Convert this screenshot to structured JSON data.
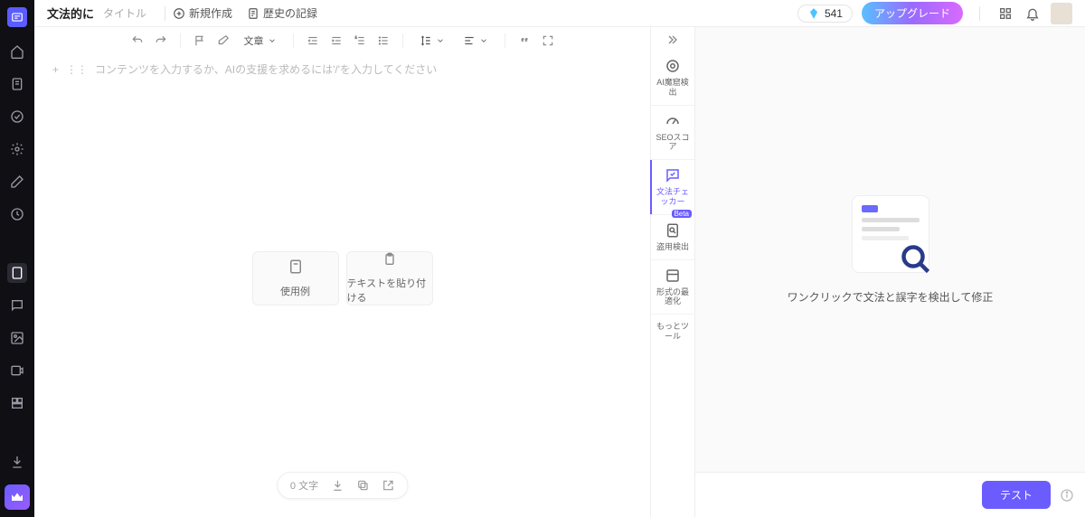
{
  "header": {
    "title": "文法的に",
    "subtitle": "タイトル",
    "new": "新規作成",
    "history": "歴史の記録",
    "credits": "541",
    "upgrade": "アップグレード"
  },
  "editor": {
    "style_dropdown": "文章",
    "placeholder": "コンテンツを入力するか、AIの支援を求めるには'/'を入力してください",
    "card_example": "使用例",
    "card_paste": "テキストを貼り付ける",
    "char_count": "0 文字"
  },
  "rail": {
    "ai_detect": "AI魔窟検出",
    "seo": "SEOスコア",
    "grammar": "文法チェッカー",
    "plagiarism": "盗用検出",
    "beta": "Beta",
    "format": "形式の最適化",
    "more": "もっとツール"
  },
  "right": {
    "description": "ワンクリックで文法と誤字を検出して修正",
    "test_button": "テスト"
  }
}
